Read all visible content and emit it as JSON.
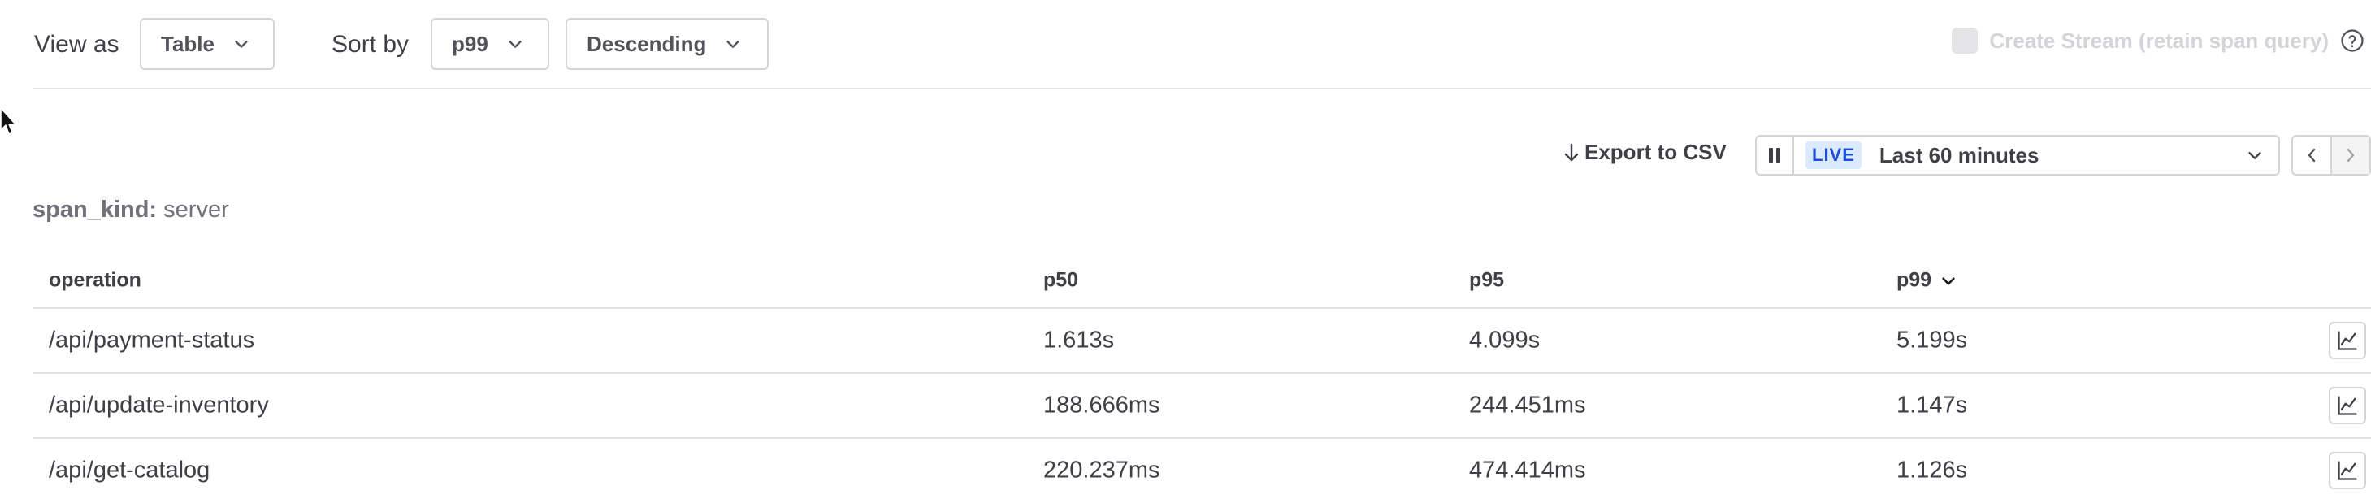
{
  "toolbar": {
    "view_as_label": "View as",
    "view_as_value": "Table",
    "sort_by_label": "Sort by",
    "sort_field_value": "p99",
    "sort_order_value": "Descending",
    "create_stream_label": "Create Stream (retain span query)",
    "create_stream_checked": false
  },
  "actions": {
    "export_label": "Export to CSV",
    "live_badge": "LIVE",
    "time_range": "Last 60 minutes"
  },
  "group": {
    "key": "span_kind:",
    "value": "server"
  },
  "table": {
    "headers": [
      "operation",
      "p50",
      "p95",
      "p99"
    ],
    "sorted_column": "p99",
    "rows": [
      {
        "operation": "/api/payment-status",
        "p50": "1.613s",
        "p95": "4.099s",
        "p99": "5.199s"
      },
      {
        "operation": "/api/update-inventory",
        "p50": "188.666ms",
        "p95": "244.451ms",
        "p99": "1.147s"
      },
      {
        "operation": "/api/get-catalog",
        "p50": "220.237ms",
        "p95": "474.414ms",
        "p99": "1.126s"
      }
    ]
  },
  "icons": [
    "chevron-down-icon",
    "help-circle-icon",
    "arrow-down-icon",
    "pause-icon",
    "chevron-left-icon",
    "chevron-right-icon",
    "line-chart-icon",
    "mouse-cursor-icon"
  ],
  "colors": {
    "accent_live_bg": "#dbeafe",
    "accent_live_text": "#1d4ed8",
    "border": "#d4d4d8",
    "text": "#3f3f46"
  }
}
